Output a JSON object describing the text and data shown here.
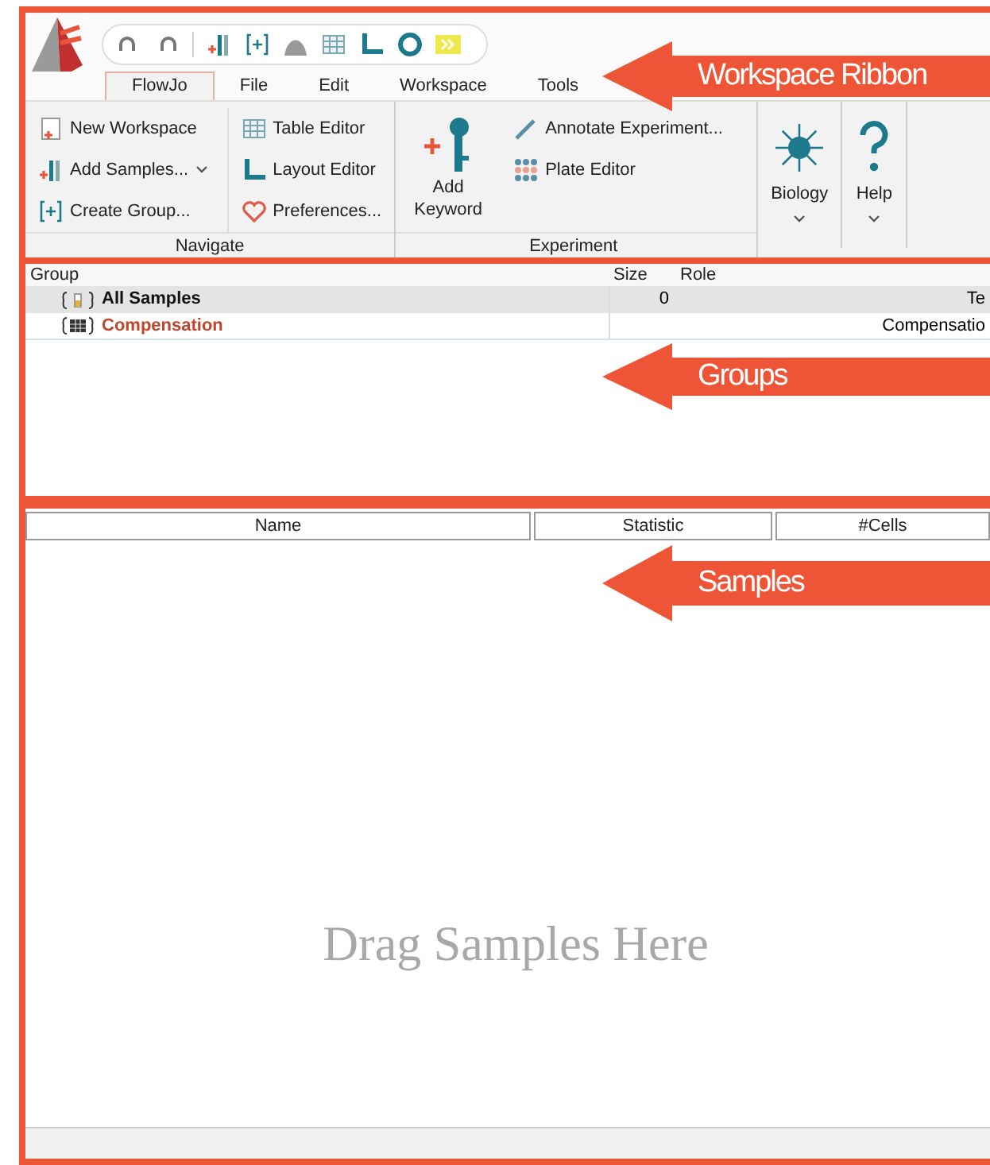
{
  "menu_tabs": [
    {
      "label": "FlowJo",
      "selected": true
    },
    {
      "label": "File",
      "selected": false
    },
    {
      "label": "Edit",
      "selected": false
    },
    {
      "label": "Workspace",
      "selected": false
    },
    {
      "label": "Tools",
      "selected": false
    }
  ],
  "ribbon_groups": [
    {
      "title": "Navigate",
      "columns": [
        [
          {
            "label": "New Workspace",
            "dropdown": false
          },
          {
            "label": "Add Samples...",
            "dropdown": true
          },
          {
            "label": "Create Group...",
            "dropdown": false
          }
        ],
        [
          {
            "label": "Table Editor",
            "dropdown": false
          },
          {
            "label": "Layout Editor",
            "dropdown": false
          },
          {
            "label": "Preferences...",
            "dropdown": false
          }
        ]
      ]
    },
    {
      "title": "Experiment",
      "big": {
        "label": "Add Keyword"
      },
      "columns": [
        [
          {
            "label": "Annotate Experiment...",
            "dropdown": false
          },
          {
            "label": "Plate Editor",
            "dropdown": false
          }
        ]
      ]
    }
  ],
  "big_buttons": [
    {
      "label": "Biology"
    },
    {
      "label": "Help"
    }
  ],
  "groups": {
    "columns": [
      "Group",
      "Size",
      "Role"
    ],
    "rows": [
      {
        "name": "All Samples",
        "kind": "all",
        "size": "0",
        "role": "Te",
        "selected": true
      },
      {
        "name": "Compensation",
        "kind": "comp",
        "size": "",
        "role": "Compensatio",
        "selected": false
      }
    ]
  },
  "samples": {
    "columns": [
      "Name",
      "Statistic",
      "#Cells"
    ],
    "empty_text": "Drag Samples Here"
  },
  "annotations": [
    {
      "label": "Workspace Ribbon"
    },
    {
      "label": "Groups"
    },
    {
      "label": "Samples"
    }
  ]
}
